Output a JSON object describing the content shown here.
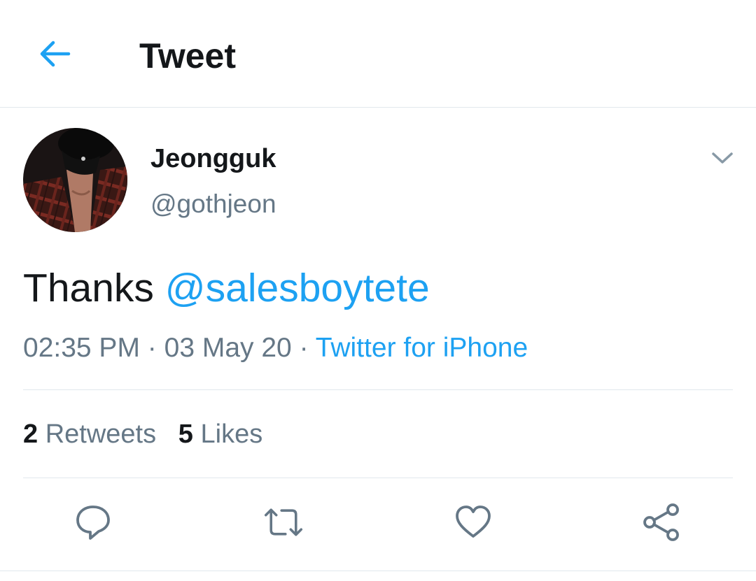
{
  "header": {
    "title": "Tweet",
    "back_icon": "back-arrow-icon"
  },
  "colors": {
    "accent": "#1da1f2",
    "text_primary": "#14171a",
    "text_secondary": "#657786",
    "divider": "#e1e8ed"
  },
  "author": {
    "name": "Jeongguk",
    "handle": "@gothjeon"
  },
  "tweet": {
    "text": "Thanks",
    "mention": "@salesboytete"
  },
  "meta": {
    "time": "02:35 PM",
    "sep1": "·",
    "date": "03 May 20",
    "sep2": "·",
    "source": "Twitter for iPhone"
  },
  "stats": {
    "retweets_count": "2",
    "retweets_label": "Retweets",
    "likes_count": "5",
    "likes_label": "Likes"
  },
  "actions": [
    {
      "name": "reply",
      "icon": "reply-icon"
    },
    {
      "name": "retweet",
      "icon": "retweet-icon"
    },
    {
      "name": "like",
      "icon": "heart-icon"
    },
    {
      "name": "share",
      "icon": "share-icon"
    }
  ]
}
